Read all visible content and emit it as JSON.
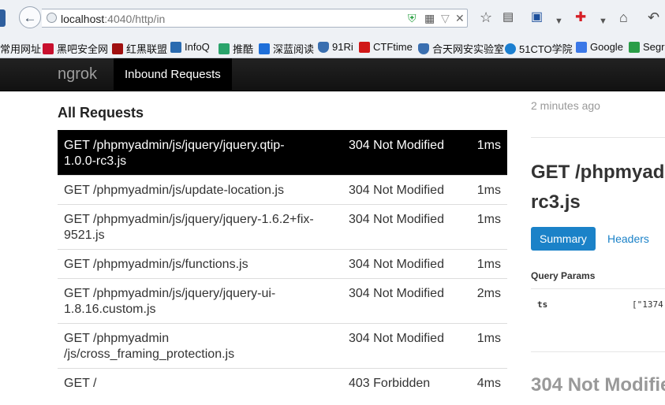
{
  "browser": {
    "url_host": "localhost",
    "url_port": ":4040",
    "url_path": "/http/in",
    "bookmarks": [
      {
        "label": "常用网址",
        "icon": "folder-icon",
        "color": "#e0b040"
      },
      {
        "label": "黑吧安全网",
        "icon": "hackbar-logo-icon",
        "color": "#c8102e"
      },
      {
        "label": "红黑联盟",
        "icon": "redblack-logo-icon",
        "color": "#a01010"
      },
      {
        "label": "InfoQ",
        "icon": "infoq-logo-icon",
        "color": "#2a6bb0"
      },
      {
        "label": "推酷",
        "icon": "tuicool-logo-icon",
        "color": "#2aa36b"
      },
      {
        "label": "深蓝阅读",
        "icon": "bookmark-flag-icon",
        "color": "#1e6fd9"
      },
      {
        "label": "91Ri",
        "icon": "shield-icon",
        "color": "#3a6fb0"
      },
      {
        "label": "CTFtime",
        "icon": "ctftime-logo-icon",
        "color": "#d01818"
      },
      {
        "label": "合天网安实验室",
        "icon": "shield-icon",
        "color": "#3a6fb0"
      },
      {
        "label": "51CTO学院",
        "icon": "play-circle-icon",
        "color": "#1b7fd0"
      },
      {
        "label": "Google",
        "icon": "google-logo-icon",
        "color": "#3b78e7"
      },
      {
        "label": "Segr",
        "icon": "segmentfault-logo-icon",
        "color": "#2a9d47"
      }
    ]
  },
  "nav": {
    "brand": "ngrok",
    "active_tab": "Inbound Requests"
  },
  "requests": {
    "title": "All Requests",
    "rows": [
      {
        "method_path": "GET /phpmyadmin/js/jquery/jquery.qtip-1.0.0-rc3.js",
        "status": "304 Not Modified",
        "duration": "1ms",
        "selected": true
      },
      {
        "method_path": "GET /phpmyadmin/js/update-location.js",
        "status": "304 Not Modified",
        "duration": "1ms"
      },
      {
        "method_path": "GET /phpmyadmin/js/jquery/jquery-1.6.2+fix-9521.js",
        "status": "304 Not Modified",
        "duration": "1ms"
      },
      {
        "method_path": "GET /phpmyadmin/js/functions.js",
        "status": "304 Not Modified",
        "duration": "1ms"
      },
      {
        "method_path": "GET /phpmyadmin/js/jquery/jquery-ui-1.8.16.custom.js",
        "status": "304 Not Modified",
        "duration": "2ms"
      },
      {
        "method_path": "GET /phpmyadmin /js/cross_framing_protection.js",
        "status": "304 Not Modified",
        "duration": "1ms"
      },
      {
        "method_path": "GET /",
        "status": "403 Forbidden",
        "duration": "4ms"
      }
    ]
  },
  "detail": {
    "time_ago": "2 minutes ago",
    "title_line1": "GET /phpmyad",
    "title_line2": "rc3.js",
    "tab_summary": "Summary",
    "tab_headers": "Headers",
    "query_params_title": "Query Params",
    "param_key": "ts",
    "param_value": "[\"1374",
    "response_status": "304 Not Modifie"
  }
}
